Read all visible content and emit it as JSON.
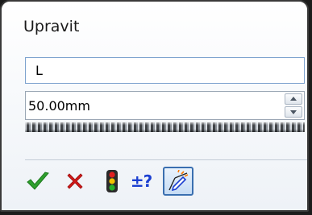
{
  "dialog": {
    "title": "Upravit",
    "name_field": {
      "value": "L"
    },
    "value_field": {
      "value": "50.00mm"
    }
  },
  "toolbar": {
    "buttons": [
      {
        "icon": "checkmark-icon",
        "color": "#2ea02e"
      },
      {
        "icon": "x-icon",
        "color": "#d01818"
      },
      {
        "icon": "traffic-light-icon",
        "colors": [
          "#e02020",
          "#f2c200",
          "#28b028"
        ]
      },
      {
        "icon": "plus-minus-question-icon",
        "label": "±?",
        "color": "#1b3fd1"
      },
      {
        "icon": "dimension-pencil-icon",
        "active": true
      }
    ]
  }
}
